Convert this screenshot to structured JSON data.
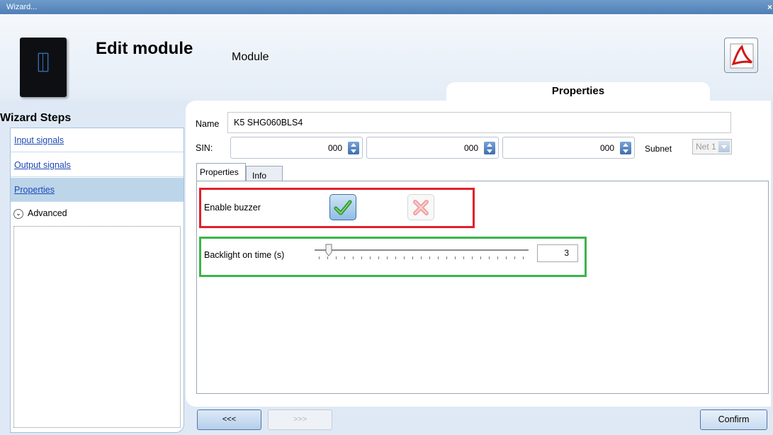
{
  "window": {
    "title": "Wizard...",
    "close_glyph": "×"
  },
  "header": {
    "title": "Edit module",
    "subtitle": "Module",
    "tab_label": "Properties",
    "icon": "pdf-document-icon"
  },
  "sidebar": {
    "title": "Wizard Steps",
    "items": [
      {
        "label": "Input signals",
        "active": false
      },
      {
        "label": "Output signals",
        "active": false
      },
      {
        "label": "Properties",
        "active": true
      }
    ],
    "advanced": {
      "label": "Advanced",
      "icon": "chevron-down-icon"
    }
  },
  "form": {
    "name_label": "Name",
    "name_value": "K5 SHG060BLS4",
    "sin_label": "SIN:",
    "sin_values": [
      "000",
      "000",
      "000"
    ],
    "subnet_label": "Subnet",
    "subnet_value": "Net 1"
  },
  "tabs": [
    {
      "label": "Properties",
      "active": true
    },
    {
      "label": "Info",
      "active": false
    }
  ],
  "properties": {
    "buzzer_label": "Enable buzzer",
    "buzzer_enabled": true,
    "backlight_label": "Backlight on time (s)",
    "backlight_value": "3",
    "backlight_fraction": 0.04
  },
  "footer": {
    "back_label": "<<<",
    "forward_label": ">>>",
    "confirm_label": "Confirm"
  },
  "colors": {
    "highlight_red": "#e0202a",
    "highlight_green": "#3bb54a",
    "link_blue": "#1f49b8"
  }
}
